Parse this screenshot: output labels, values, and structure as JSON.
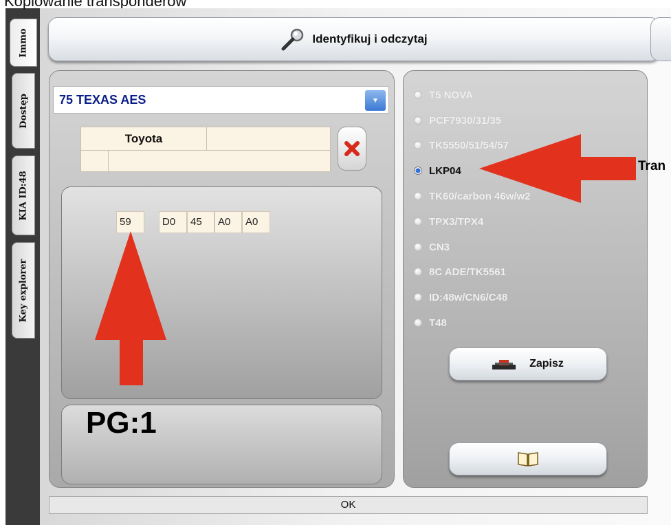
{
  "page": {
    "title": "Kopiowanie transponderów"
  },
  "tabs": [
    {
      "label": "Immo",
      "active": true
    },
    {
      "label": "Dostęp",
      "active": false
    },
    {
      "label": "KIA ID:48",
      "active": false
    },
    {
      "label": "Key explorer",
      "active": false
    }
  ],
  "toolbar": {
    "identify_label": "Identyfikuj i odczytaj",
    "identify_icon": "magnifier-icon"
  },
  "transponder_select": {
    "value": "75 TEXAS AES"
  },
  "vehicle_grid": {
    "make": "Toyota"
  },
  "hex_values": [
    "59",
    "D0",
    "45",
    "A0",
    "A0"
  ],
  "pg": {
    "label": "PG:1"
  },
  "transponder_types": [
    {
      "label": "T5 NOVA",
      "selected": false
    },
    {
      "label": "PCF7930/31/35",
      "selected": false
    },
    {
      "label": "TK5550/51/54/57",
      "selected": false
    },
    {
      "label": "LKP04",
      "selected": true
    },
    {
      "label": "TK60/carbon 46w/w2",
      "selected": false
    },
    {
      "label": "TPX3/TPX4",
      "selected": false
    },
    {
      "label": "CN3",
      "selected": false
    },
    {
      "label": "8C ADE/TK5561",
      "selected": false
    },
    {
      "label": "ID:48w/CN6/C48",
      "selected": false
    },
    {
      "label": "T48",
      "selected": false
    }
  ],
  "actions": {
    "save_label": "Zapisz",
    "book_icon": "book-icon"
  },
  "status": {
    "text": "OK"
  },
  "annotations": {
    "right_text": "Tran",
    "arrow_color": "#e2311d"
  }
}
